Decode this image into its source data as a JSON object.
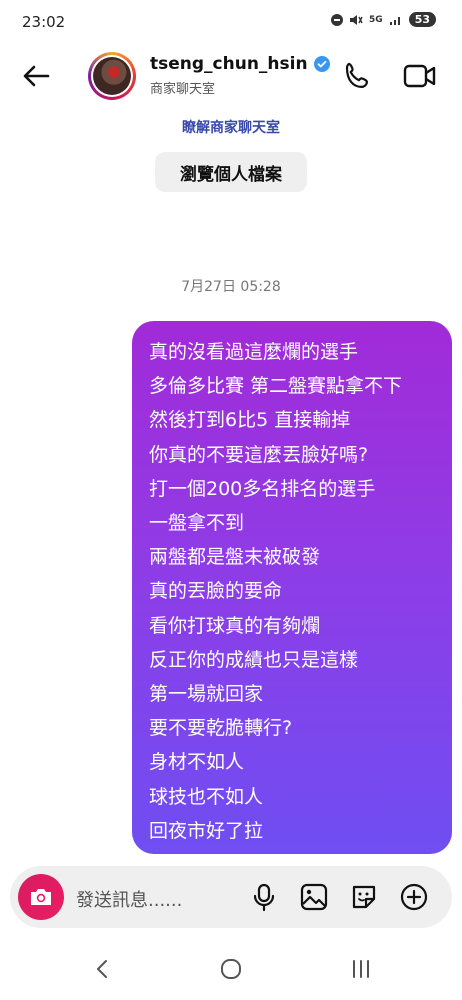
{
  "status_bar": {
    "time": "23:02",
    "network": "5G",
    "battery": "53"
  },
  "header": {
    "username": "tseng_chun_hsin",
    "account_type": "商家聊天室"
  },
  "learn_link": "瞭解商家聊天室",
  "profile_button": "瀏覽個人檔案",
  "timestamp": "7月27日 05:28",
  "message": {
    "lines": [
      "真的沒看過這麼爛的選手",
      "多倫多比賽 第二盤賽點拿不下",
      "然後打到6比5 直接輸掉",
      "你真的不要這麼丟臉好嗎?",
      "打一個200多名排名的選手",
      "一盤拿不到",
      "兩盤都是盤末被破發",
      "真的丟臉的要命",
      "看你打球真的有夠爛",
      "反正你的成績也只是這樣",
      "第一場就回家",
      "要不要乾脆轉行?",
      "身材不如人",
      "球技也不如人",
      "回夜市好了拉"
    ],
    "gradient_top": "#a12bd8",
    "gradient_bottom": "#6f4ef2"
  },
  "composer": {
    "placeholder": "發送訊息......"
  },
  "colors": {
    "link": "#3949ab",
    "verified": "#3897f0",
    "camera": "#e91e63"
  },
  "icons": [
    "back-arrow-icon",
    "verified-badge-icon",
    "phone-icon",
    "video-camera-icon",
    "camera-icon",
    "microphone-icon",
    "image-icon",
    "sticker-icon",
    "add-icon",
    "nav-back-icon",
    "nav-home-icon",
    "nav-recents-icon"
  ]
}
